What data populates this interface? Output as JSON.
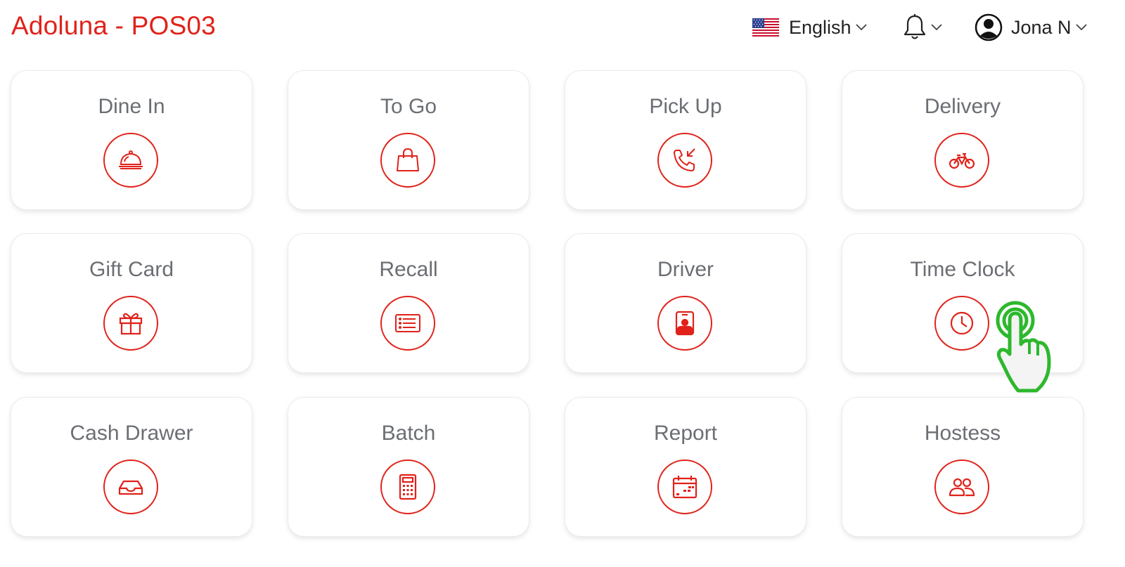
{
  "header": {
    "app_title": "Adoluna - POS03",
    "language": {
      "label": "English",
      "flag_icon": "us-flag-icon"
    },
    "notifications": {
      "icon": "bell-icon"
    },
    "user": {
      "name": "Jona N",
      "icon": "user-circle-icon"
    }
  },
  "colors": {
    "accent": "#e0221a",
    "tile_label": "#6b6e73",
    "cursor_green": "#2db82d"
  },
  "tiles": [
    {
      "label": "Dine In",
      "icon": "cloche-icon"
    },
    {
      "label": "To Go",
      "icon": "shopping-bag-icon"
    },
    {
      "label": "Pick Up",
      "icon": "incoming-call-icon"
    },
    {
      "label": "Delivery",
      "icon": "bicycle-icon"
    },
    {
      "label": "Gift Card",
      "icon": "gift-icon"
    },
    {
      "label": "Recall",
      "icon": "receipt-list-icon"
    },
    {
      "label": "Driver",
      "icon": "id-badge-icon"
    },
    {
      "label": "Time Clock",
      "icon": "clock-icon"
    },
    {
      "label": "Cash Drawer",
      "icon": "inbox-tray-icon"
    },
    {
      "label": "Batch",
      "icon": "calculator-icon"
    },
    {
      "label": "Report",
      "icon": "calendar-icon"
    },
    {
      "label": "Hostess",
      "icon": "people-icon"
    }
  ],
  "pointer": {
    "icon": "tap-hand-icon",
    "target": "Time Clock"
  }
}
